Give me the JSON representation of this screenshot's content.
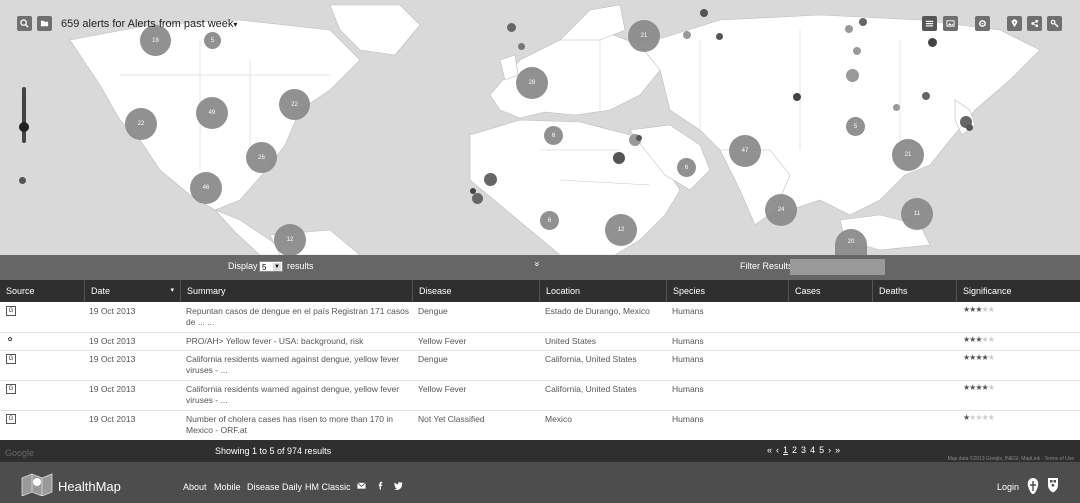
{
  "header": {
    "alert_title": "659 alerts for Alerts from past week",
    "title_caret": "▾"
  },
  "map": {
    "clusters": [
      "18",
      "5",
      "21",
      "28",
      "49",
      "22",
      "22",
      "26",
      "46",
      "12",
      "6",
      "6",
      "47",
      "5",
      "21",
      "24",
      "11",
      "20",
      "12",
      "6"
    ]
  },
  "controls": {
    "display_label": "Display",
    "display_value": "5",
    "results_label": "results",
    "filter_label": "Filter Results",
    "collapse_icon": "»"
  },
  "table": {
    "columns": {
      "source": "Source",
      "date": "Date",
      "summary": "Summary",
      "disease": "Disease",
      "location": "Location",
      "species": "Species",
      "cases": "Cases",
      "deaths": "Deaths",
      "significance": "Significance"
    },
    "sort_indicator": "▾",
    "rows": [
      {
        "source_icon": "google-news-icon",
        "source_glyph": "G",
        "date": "19 Oct 2013",
        "summary": "Repuntan casos de dengue en el país Registran 171 casos de ... ...",
        "disease": "Dengue",
        "location": "Estado de Durango, Mexico",
        "species": "Humans",
        "cases": "",
        "deaths": "",
        "stars": 3
      },
      {
        "source_icon": "promed-icon",
        "source_glyph": "✿",
        "date": "19 Oct 2013",
        "summary": "PRO/AH> Yellow fever - USA: background, risk",
        "disease": "Yellow Fever",
        "location": "United States",
        "species": "Humans",
        "cases": "",
        "deaths": "",
        "stars": 3
      },
      {
        "source_icon": "google-news-icon",
        "source_glyph": "G",
        "date": "19 Oct 2013",
        "summary": "California residents warned against dengue, yellow fever viruses - ...",
        "disease": "Dengue",
        "location": "California, United States",
        "species": "Humans",
        "cases": "",
        "deaths": "",
        "stars": 4
      },
      {
        "source_icon": "google-news-icon",
        "source_glyph": "G",
        "date": "19 Oct 2013",
        "summary": "California residents warned against dengue, yellow fever viruses - ...",
        "disease": "Yellow Fever",
        "location": "California, United States",
        "species": "Humans",
        "cases": "",
        "deaths": "",
        "stars": 4
      },
      {
        "source_icon": "google-news-icon",
        "source_glyph": "G",
        "date": "19 Oct 2013",
        "summary": "Number of cholera cases has risen to more than 170 in Mexico - ORF.at",
        "disease": "Not Yet Classified",
        "location": "Mexico",
        "species": "Humans",
        "cases": "",
        "deaths": "",
        "stars": 1
      }
    ]
  },
  "pagination": {
    "showing": "Showing 1 to 5 of 974 results",
    "first": "«",
    "prev": "‹",
    "pages": [
      "1",
      "2",
      "3",
      "4",
      "5"
    ],
    "next": "›",
    "last": "»",
    "google_mark": "Google",
    "attribution": "Map data ©2013 Google, INEGI, MapLink · Terms of Use"
  },
  "footer": {
    "brand": "HealthMap",
    "links": [
      "About",
      "Mobile",
      "Disease Daily",
      "HM Classic"
    ],
    "login": "Login"
  },
  "colors": {
    "map_background": "#d9d9d9",
    "land": "#ffffff",
    "cluster": "#8c8c8c",
    "header_bar": "#2f2f2f",
    "footer": "#4d4d4d"
  }
}
